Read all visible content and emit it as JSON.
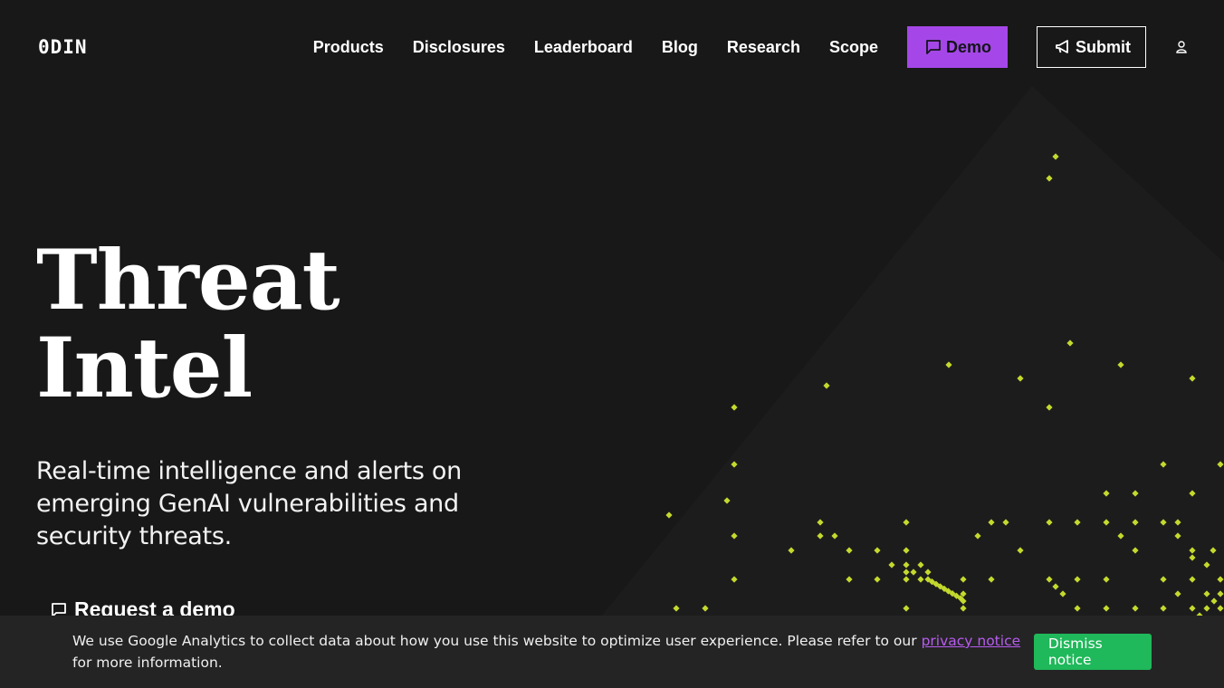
{
  "brand": {
    "logo_text": "0DIN"
  },
  "nav": {
    "items": [
      "Products",
      "Disclosures",
      "Leaderboard",
      "Blog",
      "Research",
      "Scope"
    ],
    "demo_label": "Demo",
    "demo_icon": "chat-bubble-icon",
    "submit_label": "Submit",
    "submit_icon": "megaphone-icon",
    "user_icon": "user-icon"
  },
  "hero": {
    "title_line1": "Threat",
    "title_line2": "Intel",
    "subtitle": "Real-time intelligence and alerts on emerging GenAI vulnerabilities and security threats.",
    "cta_label": "Request a demo",
    "cta_icon": "chat-bubble-icon"
  },
  "cookie_banner": {
    "text_before": "We use Google Analytics to collect data about how you use this website to optimize user experience. Please refer to our",
    "link_text": "privacy notice",
    "text_after": "for more information.",
    "dismiss_label": "Dismiss notice"
  },
  "colors": {
    "background": "#181818",
    "accent_purple": "#a547e8",
    "pixel_green": "#c4d92e",
    "dismiss_green": "#1fb85a",
    "link_purple": "#b75cf0"
  }
}
